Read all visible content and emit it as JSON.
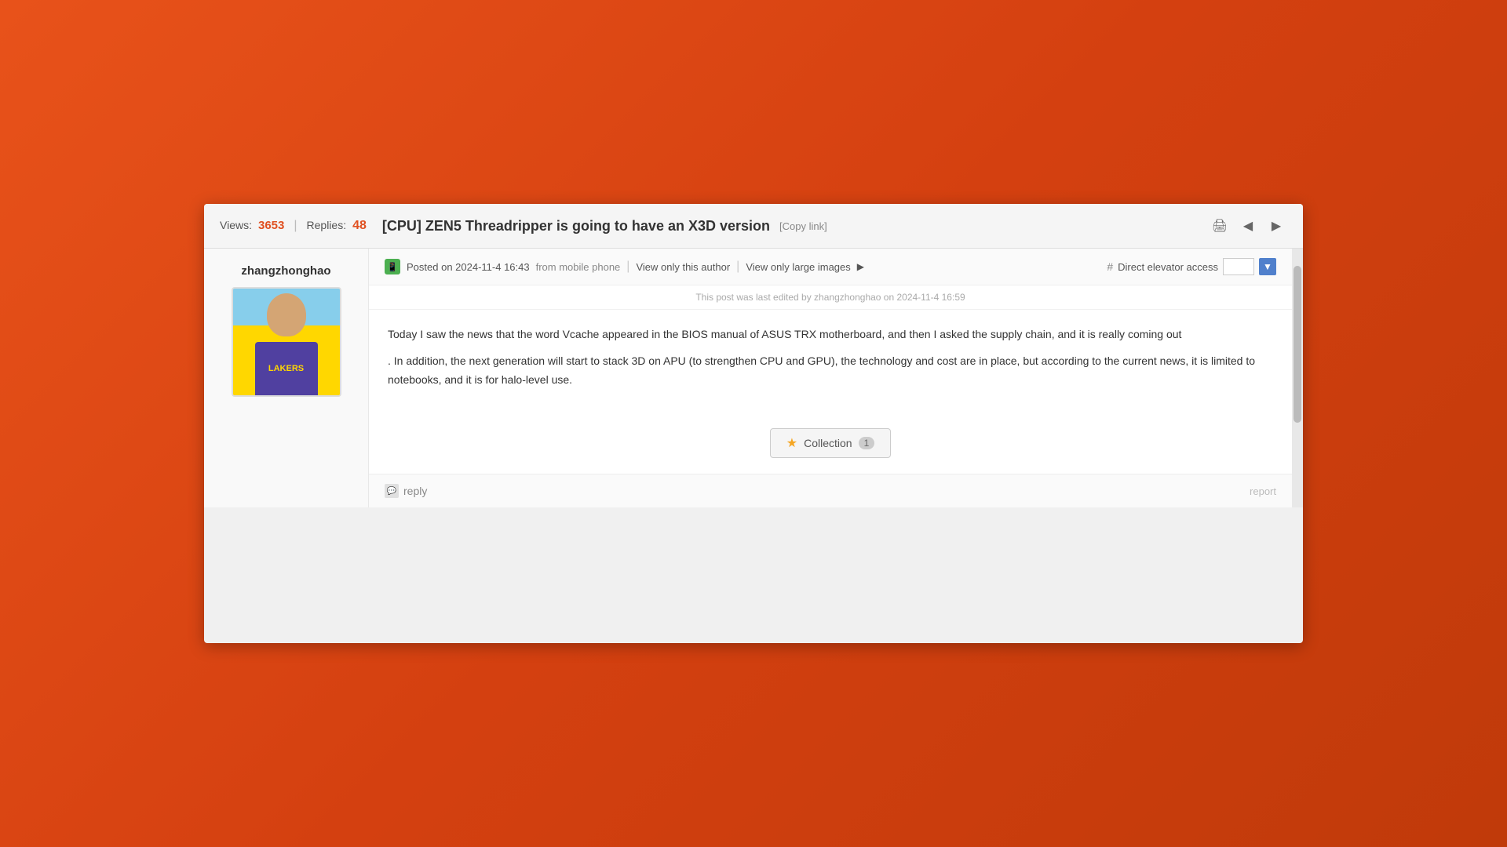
{
  "background": {
    "gradient_start": "#e8521a",
    "gradient_end": "#c03a0a"
  },
  "header": {
    "views_label": "Views:",
    "views_count": "3653",
    "replies_label": "Replies:",
    "replies_count": "48",
    "title": "[CPU] ZEN5 Threadripper is going to have an X3D version",
    "copy_link_label": "[Copy link]",
    "print_icon": "🖨",
    "back_icon": "◀",
    "forward_icon": "▶"
  },
  "sidebar": {
    "username": "zhangzhonghao",
    "avatar_alt": "User avatar - Lakers jersey"
  },
  "post": {
    "mobile_icon": "📱",
    "posted_label": "Posted on 2024-11-4 16:43",
    "from_mobile": "from mobile phone",
    "view_only_author": "View only this author",
    "view_only_images": "View only large images",
    "elevator_hash": "#",
    "elevator_label": "Direct elevator access",
    "elevator_placeholder": "",
    "edit_notice": "This post was last edited by zhangzhonghao on 2024-11-4 16:59",
    "body_line1": "Today I saw the news that the word Vcache appeared in the BIOS manual of ASUS TRX motherboard, and then I asked the supply chain, and it is really coming out",
    "body_line2": ". In addition, the next generation will start to stack 3D on APU (to strengthen CPU and GPU), the technology and cost are in place, but according to the current news, it is limited to notebooks, and it is for halo-level use.",
    "collection_label": "Collection",
    "collection_count": "1",
    "reply_label": "reply",
    "report_label": "report"
  }
}
